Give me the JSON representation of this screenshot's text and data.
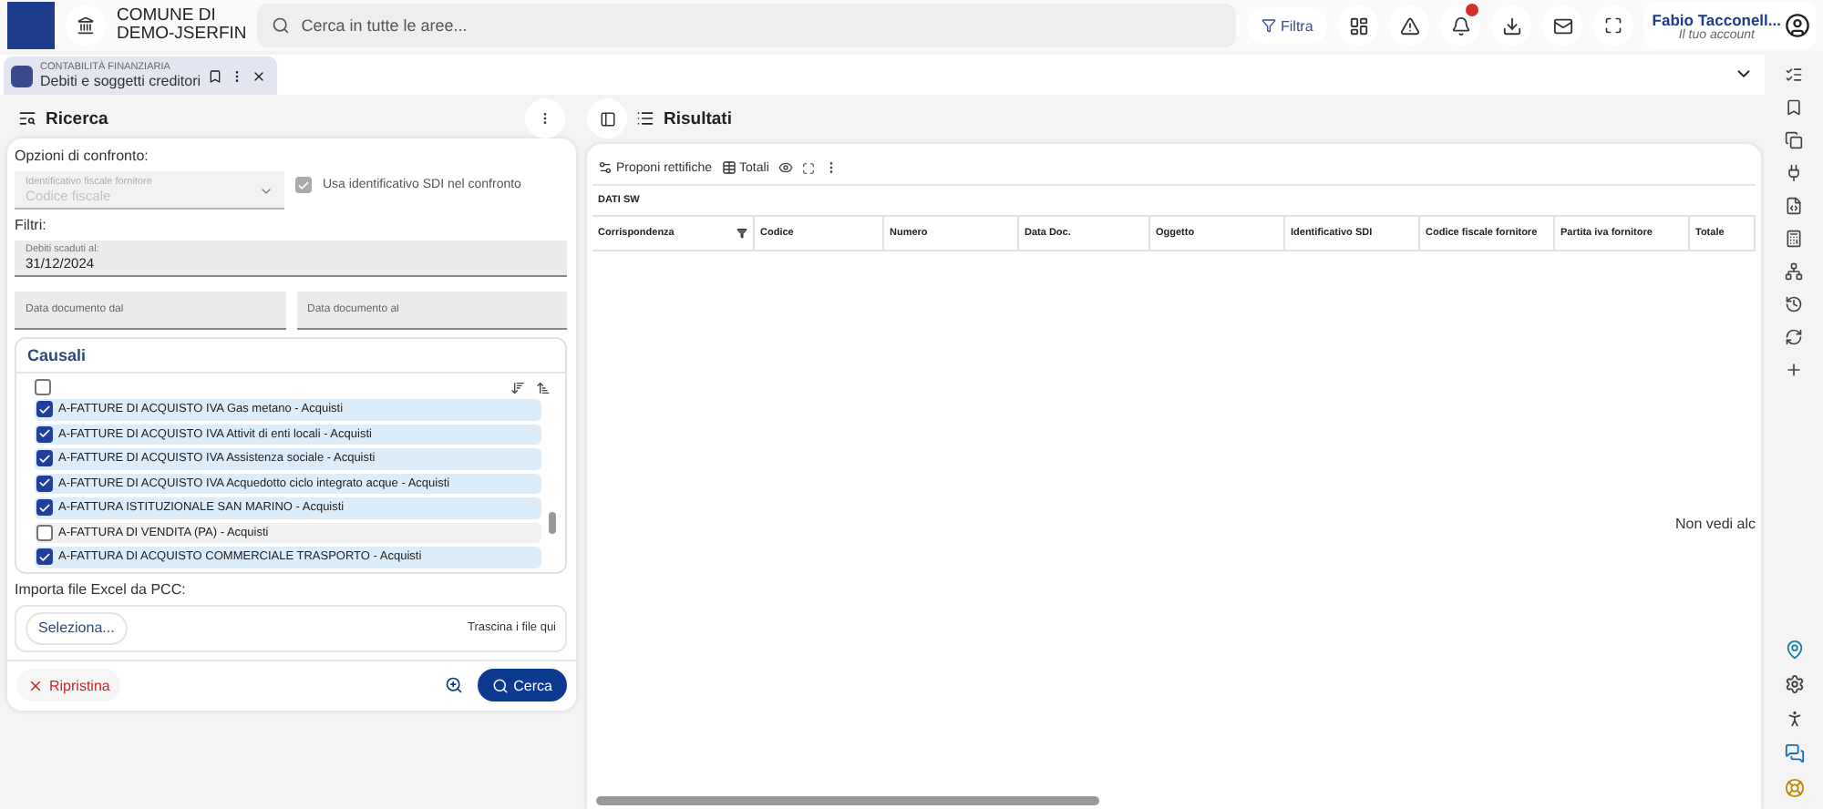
{
  "header": {
    "org_lines": [
      "COMUNE DI",
      "DEMO-JSERFIN"
    ],
    "search": {
      "placeholder": "Cerca in tutte le aree..."
    },
    "filter_button": "Filtra",
    "user": {
      "name": "Fabio Tacconell...",
      "subtitle": "Il tuo account"
    }
  },
  "tab": {
    "category": "CONTABILITÀ FINANZIARIA",
    "title": "Debiti e soggetti creditori",
    "selected": true
  },
  "search_panel": {
    "title": "Ricerca",
    "options_label": "Opzioni di confronto:",
    "select": {
      "label": "Identificativo fiscale fornitore",
      "value": "Codice fiscale",
      "disabled": true
    },
    "sdi_checkbox": {
      "label": "Usa identificativo SDI nel confronto",
      "checked": true,
      "disabled": true
    },
    "filters_label": "Filtri:",
    "due_field": {
      "label": "Debiti scaduti al:",
      "value": "31/12/2024"
    },
    "date_fields": [
      {
        "placeholder": "Data documento dal"
      },
      {
        "placeholder": "Data documento al"
      }
    ],
    "causali": {
      "title": "Causali",
      "select_all_checked": false,
      "items": [
        {
          "label": "A-FATTURE DI ACQUISTO IVA Gas metano - Acquisti",
          "checked": true
        },
        {
          "label": "A-FATTURE DI ACQUISTO IVA Attivit di enti locali - Acquisti",
          "checked": true
        },
        {
          "label": "A-FATTURE DI ACQUISTO IVA Assistenza sociale - Acquisti",
          "checked": true
        },
        {
          "label": "A-FATTURE DI ACQUISTO IVA Acquedotto ciclo integrato acque - Acquisti",
          "checked": true
        },
        {
          "label": "A-FATTURA ISTITUZIONALE SAN MARINO - Acquisti",
          "checked": true
        },
        {
          "label": "A-FATTURA DI VENDITA (PA) - Acquisti",
          "checked": false
        },
        {
          "label": "A-FATTURA DI ACQUISTO COMMERCIALE TRASPORTO - Acquisti",
          "checked": true
        }
      ]
    },
    "import": {
      "label": "Importa file Excel da PCC:",
      "button": "Seleziona...",
      "hint": "Trascina i file qui"
    },
    "reset_button": "Ripristina",
    "search_button": "Cerca"
  },
  "results": {
    "title": "Risultati",
    "toolbar": [
      "Proponi rettifiche",
      "Totali"
    ],
    "section": "DATI SW",
    "columns": [
      "Corrispondenza",
      "Codice",
      "Numero",
      "Data Doc.",
      "Oggetto",
      "Identificativo SDI",
      "Codice fiscale fornitore",
      "Partita iva fornitore",
      "Totale"
    ],
    "empty_message": "Non vedi alc"
  }
}
